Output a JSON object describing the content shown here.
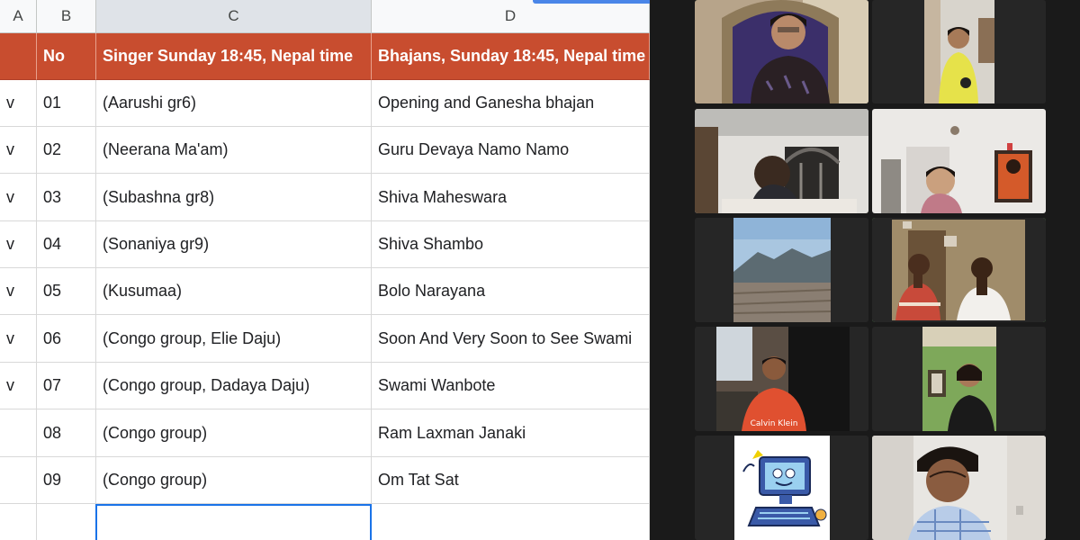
{
  "sheet": {
    "columns": [
      "A",
      "B",
      "C",
      "D"
    ],
    "header": {
      "no": "No",
      "singer": "Singer Sunday 18:45, Nepal time",
      "bhajan": "Bhajans, Sunday 18:45, Nepal time"
    },
    "rows": [
      {
        "mark": "v",
        "no": "01",
        "singer": "(Aarushi gr6)",
        "bhajan": "Opening and Ganesha bhajan"
      },
      {
        "mark": "v",
        "no": "02",
        "singer": "(Neerana Ma'am)",
        "bhajan": "Guru Devaya Namo Namo"
      },
      {
        "mark": "v",
        "no": "03",
        "singer": "(Subashna gr8)",
        "bhajan": "Shiva Maheswara"
      },
      {
        "mark": "v",
        "no": "04",
        "singer": "(Sonaniya gr9)",
        "bhajan": "Shiva Shambo"
      },
      {
        "mark": "v",
        "no": "05",
        "singer": "(Kusumaa)",
        "bhajan": "Bolo Narayana"
      },
      {
        "mark": "v",
        "no": "06",
        "singer": "(Congo group, Elie Daju)",
        "bhajan": "Soon And Very Soon to See Swami"
      },
      {
        "mark": "v",
        "no": "07",
        "singer": "(Congo group, Dadaya Daju)",
        "bhajan": "Swami Wanbote"
      },
      {
        "mark": "",
        "no": "08",
        "singer": "(Congo group)",
        "bhajan": "Ram Laxman Janaki"
      },
      {
        "mark": "",
        "no": "09",
        "singer": "(Congo group)",
        "bhajan": "Om Tat Sat"
      }
    ],
    "header_color": "#c84d2f",
    "selection_color": "#1a73e8"
  },
  "video": {
    "shirt_text": "Calvin Klein",
    "active_speaker_color": "#60d860"
  }
}
